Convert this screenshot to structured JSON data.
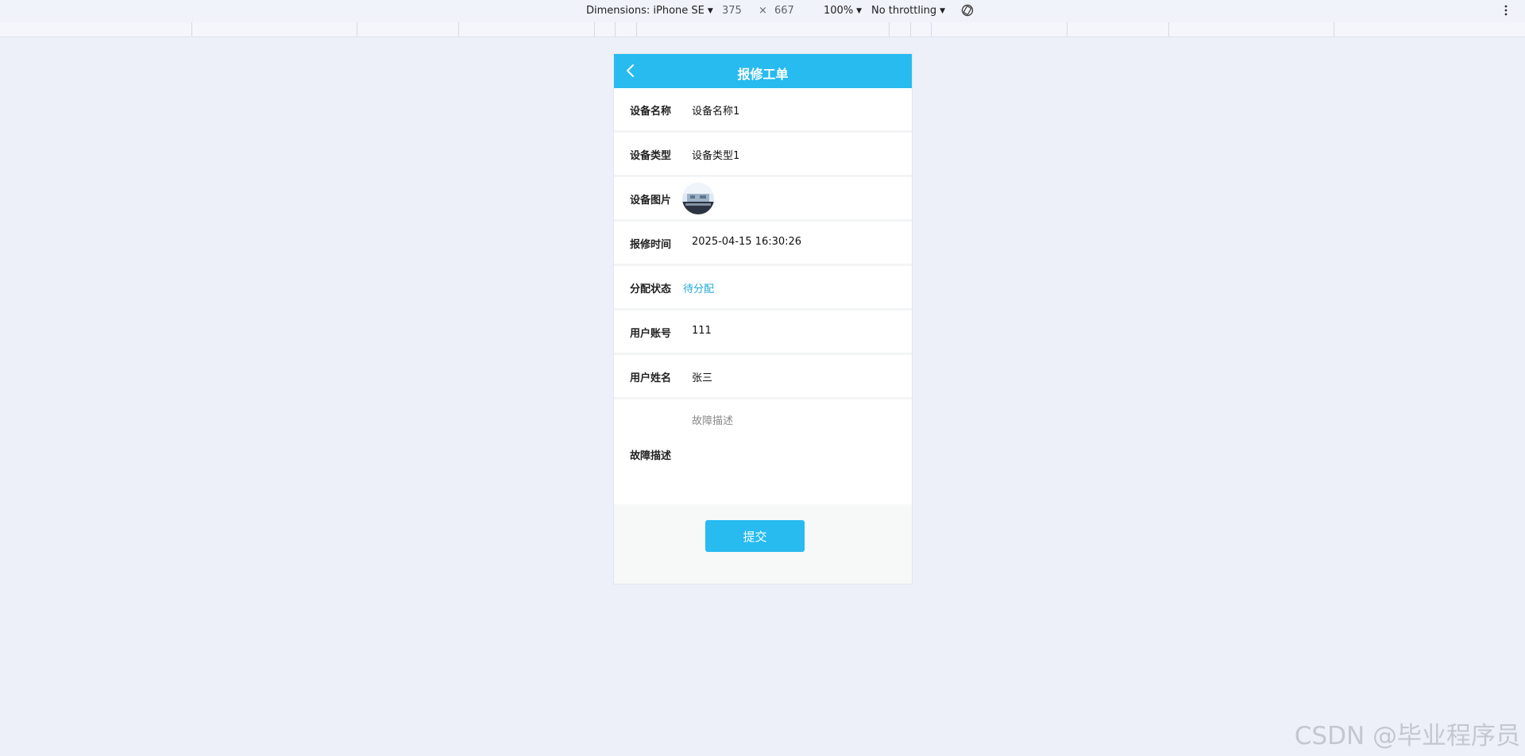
{
  "devtools": {
    "dimensions_label": "Dimensions: iPhone SE",
    "width": "375",
    "times": "×",
    "height": "667",
    "zoom": "100%",
    "throttling": "No throttling"
  },
  "page": {
    "title": "报修工单"
  },
  "fields": [
    {
      "label": "设备名称",
      "value": "设备名称1"
    },
    {
      "label": "设备类型",
      "value": "设备类型1"
    },
    {
      "label": "设备图片"
    },
    {
      "label": "报修时间",
      "value": "2025-04-15 16:30:26"
    },
    {
      "label": "分配状态",
      "value": "待分配"
    },
    {
      "label": "用户账号",
      "value": "111"
    },
    {
      "label": "用户姓名",
      "value": "张三"
    }
  ],
  "description": {
    "label": "故障描述",
    "placeholder": "故障描述",
    "value": ""
  },
  "submit_label": "提交",
  "watermark": "CSDN @毕业程序员",
  "colors": {
    "accent": "#27bbf0",
    "status": "#1fa8d8",
    "background": "#edf0f8"
  }
}
